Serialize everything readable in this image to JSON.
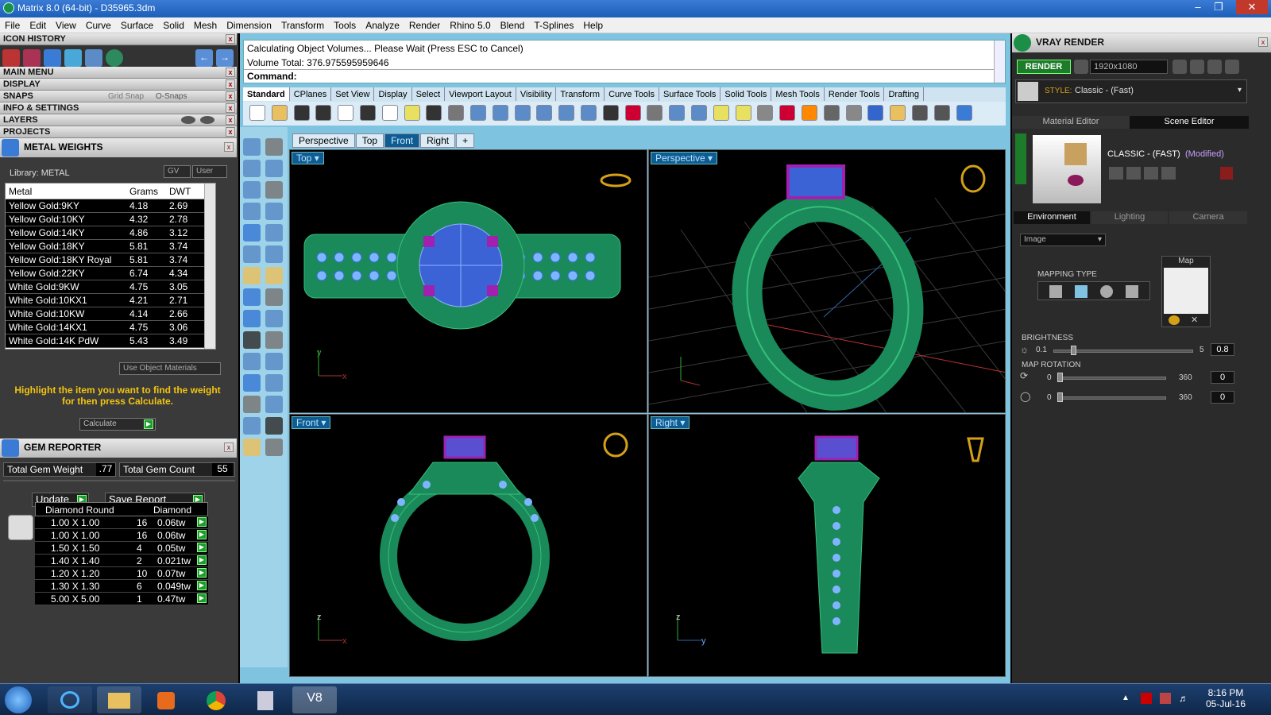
{
  "window": {
    "title": "Matrix 8.0 (64-bit) - D35965.3dm"
  },
  "menu": [
    "File",
    "Edit",
    "View",
    "Curve",
    "Surface",
    "Solid",
    "Mesh",
    "Dimension",
    "Transform",
    "Tools",
    "Analyze",
    "Render",
    "Rhino 5.0",
    "Blend",
    "T-Splines",
    "Help"
  ],
  "left": {
    "icon_history": "ICON HISTORY",
    "main_menu": "MAIN MENU",
    "display": "DISPLAY",
    "snaps": "SNAPS",
    "grid_snap": "Grid Snap",
    "o_snaps": "O-Snaps",
    "info": "INFO & SETTINGS",
    "layers": "LAYERS",
    "projects": "PROJECTS",
    "metal_weights": "METAL WEIGHTS",
    "library": "Library: METAL",
    "gv": "GV",
    "user": "User",
    "cols": [
      "Metal",
      "Grams",
      "DWT"
    ],
    "metals": [
      [
        "Yellow Gold:9KY",
        "4.18",
        "2.69"
      ],
      [
        "Yellow Gold:10KY",
        "4.32",
        "2.78"
      ],
      [
        "Yellow Gold:14KY",
        "4.86",
        "3.12"
      ],
      [
        "Yellow Gold:18KY",
        "5.81",
        "3.74"
      ],
      [
        "Yellow Gold:18KY Royal",
        "5.81",
        "3.74"
      ],
      [
        "Yellow Gold:22KY",
        "6.74",
        "4.34"
      ],
      [
        "White Gold:9KW",
        "4.75",
        "3.05"
      ],
      [
        "White Gold:10KX1",
        "4.21",
        "2.71"
      ],
      [
        "White Gold:10KW",
        "4.14",
        "2.66"
      ],
      [
        "White Gold:14KX1",
        "4.75",
        "3.06"
      ],
      [
        "White Gold:14K PdW",
        "5.43",
        "3.49"
      ]
    ],
    "use_object_materials": "Use Object Materials",
    "hint": "Highlight the item you want to find the weight for then press Calculate.",
    "calculate": "Calculate",
    "gem_reporter": "GEM REPORTER",
    "total_gem_weight_label": "Total Gem Weight",
    "total_gem_weight": ".77",
    "total_gem_count_label": "Total Gem Count",
    "total_gem_count": "55",
    "update": "Update",
    "save_report": "Save Report",
    "gem_cols": [
      "Diamond Round",
      "Diamond"
    ],
    "gems": [
      [
        "1.00 X 1.00",
        "16",
        "0.06tw"
      ],
      [
        "1.00 X 1.00",
        "16",
        "0.06tw"
      ],
      [
        "1.50 X 1.50",
        "4",
        "0.05tw"
      ],
      [
        "1.40 X 1.40",
        "2",
        "0.021tw"
      ],
      [
        "1.20 X 1.20",
        "10",
        "0.07tw"
      ],
      [
        "1.30 X 1.30",
        "6",
        "0.049tw"
      ],
      [
        "5.00 X 5.00",
        "1",
        "0.47tw"
      ]
    ]
  },
  "command": {
    "line1": "Calculating Object Volumes... Please Wait (Press ESC to Cancel)",
    "line2": "Volume Total: 376.975595959646",
    "prompt": "Command:"
  },
  "toolbar_tabs": [
    "Standard",
    "CPlanes",
    "Set View",
    "Display",
    "Select",
    "Viewport Layout",
    "Visibility",
    "Transform",
    "Curve Tools",
    "Surface Tools",
    "Solid Tools",
    "Mesh Tools",
    "Render Tools",
    "Drafting"
  ],
  "view_tabs": [
    "Perspective",
    "Top",
    "Front",
    "Right"
  ],
  "viewports": {
    "top": "Top",
    "perspective": "Perspective",
    "front": "Front",
    "right": "Right"
  },
  "right": {
    "title": "VRAY RENDER",
    "render": "RENDER",
    "resolution": "1920x1080",
    "style_label": "STYLE:",
    "style": "Classic - (Fast)",
    "tab_material": "Material Editor",
    "tab_scene": "Scene Editor",
    "preset_name": "CLASSIC - (FAST)",
    "preset_mod": "(Modified)",
    "tab_env": "Environment",
    "tab_light": "Lighting",
    "tab_camera": "Camera",
    "env_type": "Image",
    "map": "Map",
    "mapping_type": "MAPPING TYPE",
    "brightness": "BRIGHTNESS",
    "b_min": "0.1",
    "b_max": "5",
    "b_val": "0.8",
    "map_rotation": "MAP ROTATION",
    "r_min": "0",
    "r_max": "360",
    "r1_val": "0",
    "r2_val": "0"
  },
  "taskbar": {
    "time": "8:16 PM",
    "date": "05-Jul-16"
  }
}
